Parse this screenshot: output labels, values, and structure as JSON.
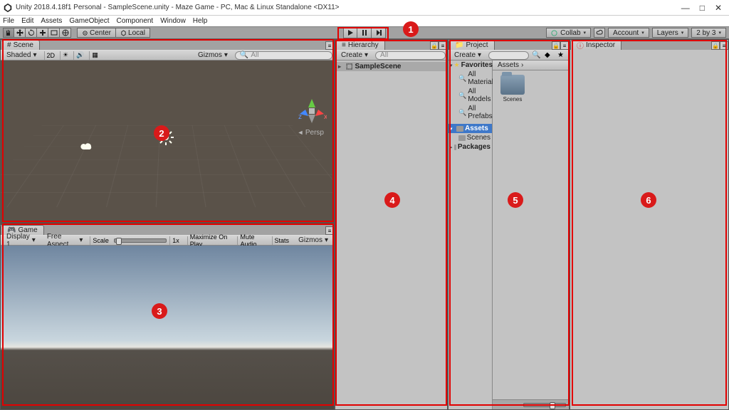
{
  "titlebar": {
    "title": "Unity 2018.4.18f1 Personal - SampleScene.unity - Maze Game - PC, Mac & Linux Standalone <DX11>"
  },
  "menu": [
    "File",
    "Edit",
    "Assets",
    "GameObject",
    "Component",
    "Window",
    "Help"
  ],
  "toolbar": {
    "pivot_center": "Center",
    "pivot_local": "Local",
    "collab": "Collab",
    "account": "Account",
    "layers": "Layers",
    "layout": "2 by 3"
  },
  "scene": {
    "tab": "Scene",
    "shading": "Shaded",
    "twod": "2D",
    "gizmos": "Gizmos",
    "persp": "Persp"
  },
  "game": {
    "tab": "Game",
    "display": "Display 1",
    "aspect": "Free Aspect",
    "scale_label": "Scale",
    "scale_value": "1x",
    "maximize": "Maximize On Play",
    "mute": "Mute Audio",
    "stats": "Stats",
    "gizmos": "Gizmos"
  },
  "hierarchy": {
    "tab": "Hierarchy",
    "create": "Create",
    "root": "SampleScene"
  },
  "project": {
    "tab": "Project",
    "create": "Create",
    "favorites": "Favorites",
    "fav_items": [
      "All Material",
      "All Models",
      "All Prefabs"
    ],
    "assets": "Assets",
    "scenes": "Scenes",
    "packages": "Packages",
    "breadcrumb": "Assets",
    "asset1": "Scenes"
  },
  "inspector": {
    "tab": "Inspector"
  },
  "search_placeholder": "All",
  "annotations": {
    "region1": "1",
    "region2": "2",
    "region3": "3",
    "region4": "4",
    "region5": "5",
    "region6": "6"
  }
}
